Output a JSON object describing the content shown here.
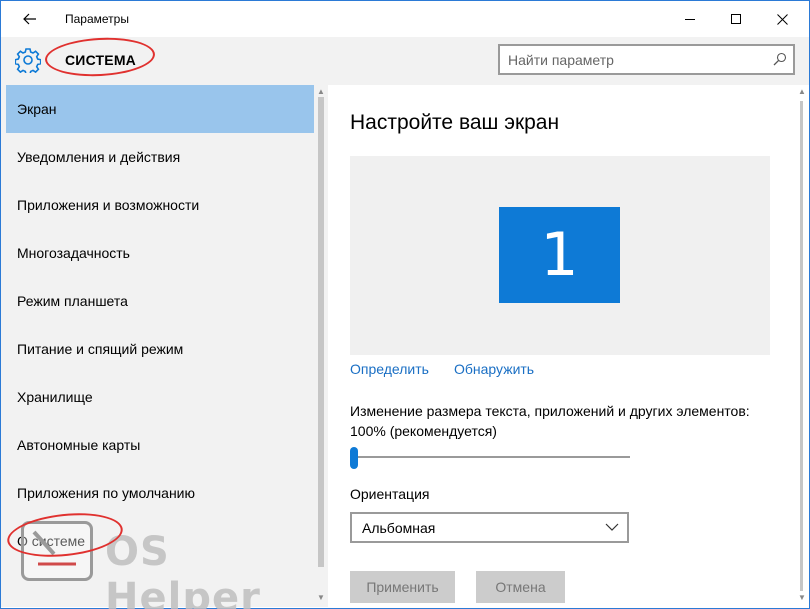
{
  "window": {
    "title": "Параметры"
  },
  "header": {
    "section_title": "СИСТЕМА",
    "search_placeholder": "Найти параметр"
  },
  "sidebar": {
    "items": [
      {
        "label": "Экран",
        "active": true
      },
      {
        "label": "Уведомления и действия",
        "active": false
      },
      {
        "label": "Приложения и возможности",
        "active": false
      },
      {
        "label": "Многозадачность",
        "active": false
      },
      {
        "label": "Режим планшета",
        "active": false
      },
      {
        "label": "Питание и спящий режим",
        "active": false
      },
      {
        "label": "Хранилище",
        "active": false
      },
      {
        "label": "Автономные карты",
        "active": false
      },
      {
        "label": "Приложения по умолчанию",
        "active": false
      },
      {
        "label": "О системе",
        "active": false
      }
    ]
  },
  "main": {
    "title": "Настройте ваш экран",
    "monitor_number": "1",
    "links": {
      "identify": "Определить",
      "detect": "Обнаружить"
    },
    "scale_label": "Изменение размера текста, приложений и других элементов: 100% (рекомендуется)",
    "scale_percent": 100,
    "orientation": {
      "label": "Ориентация",
      "selected": "Альбомная"
    },
    "buttons": {
      "apply": "Применить",
      "cancel": "Отмена"
    }
  },
  "watermark": {
    "text": "OS Helper"
  },
  "colors": {
    "accent": "#0e7ad6",
    "active_item": "#99c5ec",
    "link": "#1a6fc4",
    "annotation": "#e0312f"
  }
}
